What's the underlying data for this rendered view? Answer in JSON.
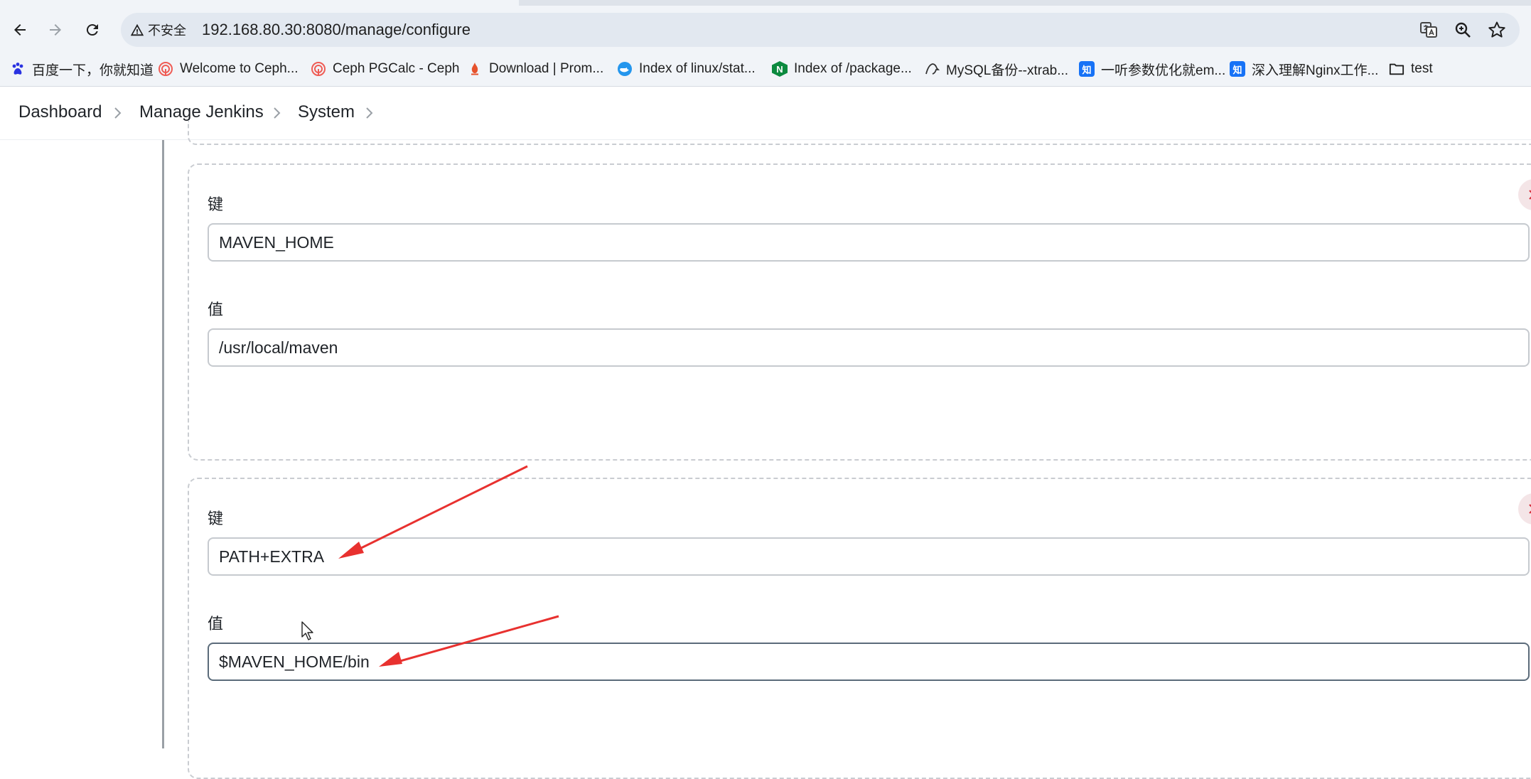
{
  "browser": {
    "security_label": "不安全",
    "url": "192.168.80.30:8080/manage/configure",
    "bookmarks": [
      {
        "label": "百度一下，你就知道",
        "icon": "baidu-paw-icon"
      },
      {
        "label": "Welcome to Ceph...",
        "icon": "ceph-icon"
      },
      {
        "label": "Ceph PGCalc - Ceph",
        "icon": "ceph-icon"
      },
      {
        "label": "Download | Prom...",
        "icon": "prometheus-icon"
      },
      {
        "label": "Index of linux/stat...",
        "icon": "docker-icon"
      },
      {
        "label": "Index of /package...",
        "icon": "nginx-icon"
      },
      {
        "label": "MySQL备份--xtrab...",
        "icon": "mysql-icon"
      },
      {
        "label": "一听参数优化就em...",
        "icon": "zhihu-icon"
      },
      {
        "label": "深入理解Nginx工作...",
        "icon": "zhihu-icon"
      },
      {
        "label": "test",
        "icon": "folder-icon"
      }
    ],
    "zhihu_glyph": "知",
    "nginx_glyph": "N"
  },
  "breadcrumb": [
    "Dashboard",
    "Manage Jenkins",
    "System"
  ],
  "env_vars": [
    {
      "key_label": "键",
      "key": "MAVEN_HOME",
      "value_label": "值",
      "value": "/usr/local/maven"
    },
    {
      "key_label": "键",
      "key": "PATH+EXTRA",
      "value_label": "值",
      "value": "$MAVEN_HOME/bin"
    }
  ],
  "colors": {
    "annotation_arrow": "#e8312f",
    "delete_icon": "#d62d3a"
  }
}
